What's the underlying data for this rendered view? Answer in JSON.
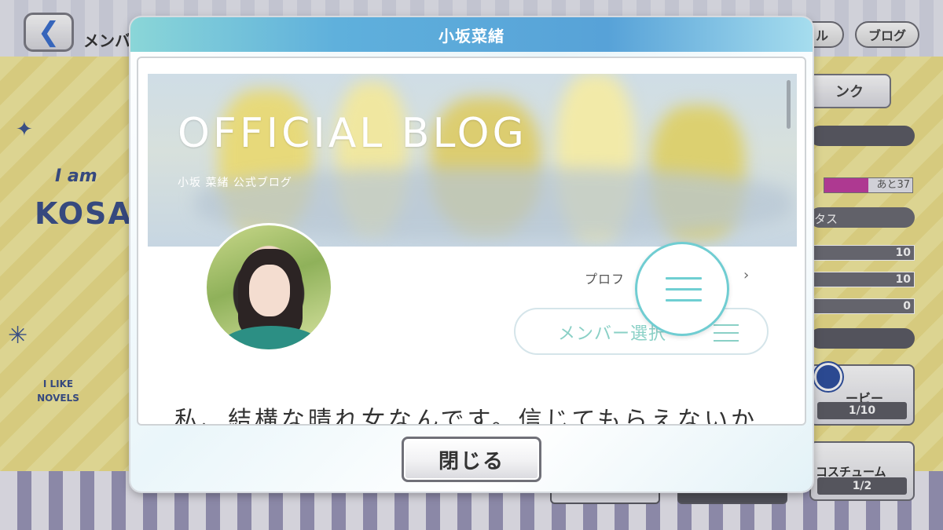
{
  "background": {
    "member_label": "メンバ",
    "top_buttons": [
      "ル",
      "ブログ"
    ],
    "rank_button": "ンク",
    "remaining_label": "あと37",
    "status_label": "タス",
    "stats": [
      "10",
      "10",
      "0"
    ],
    "movie_card": {
      "label": "ービー",
      "count": "1/10"
    },
    "costume_card": {
      "label": "コスチューム",
      "count": "1/2"
    },
    "deco_texts": [
      "I am",
      "KOSA",
      "I LIKE NOVELS"
    ]
  },
  "modal": {
    "title": "小坂菜緒",
    "blog": {
      "hero_title": "OFFICIAL BLOG",
      "hero_subtitle": "小坂 菜緒 公式ブログ",
      "profile_link": "プロフ",
      "member_select_label": "メンバー選択",
      "body_text": "私、結構な晴れ女なんです。信じてもらえないか"
    },
    "close_label": "閉じる"
  },
  "colors": {
    "header_gradient_start": "#8ad6d8",
    "header_gradient_mid": "#57a2d8",
    "accent_teal": "#70cdd2",
    "member_select_text": "#8ad0c6"
  },
  "icons": {
    "back": "chevron-left-icon",
    "menu": "hamburger-menu-icon",
    "chevron": "chevron-right-icon"
  }
}
